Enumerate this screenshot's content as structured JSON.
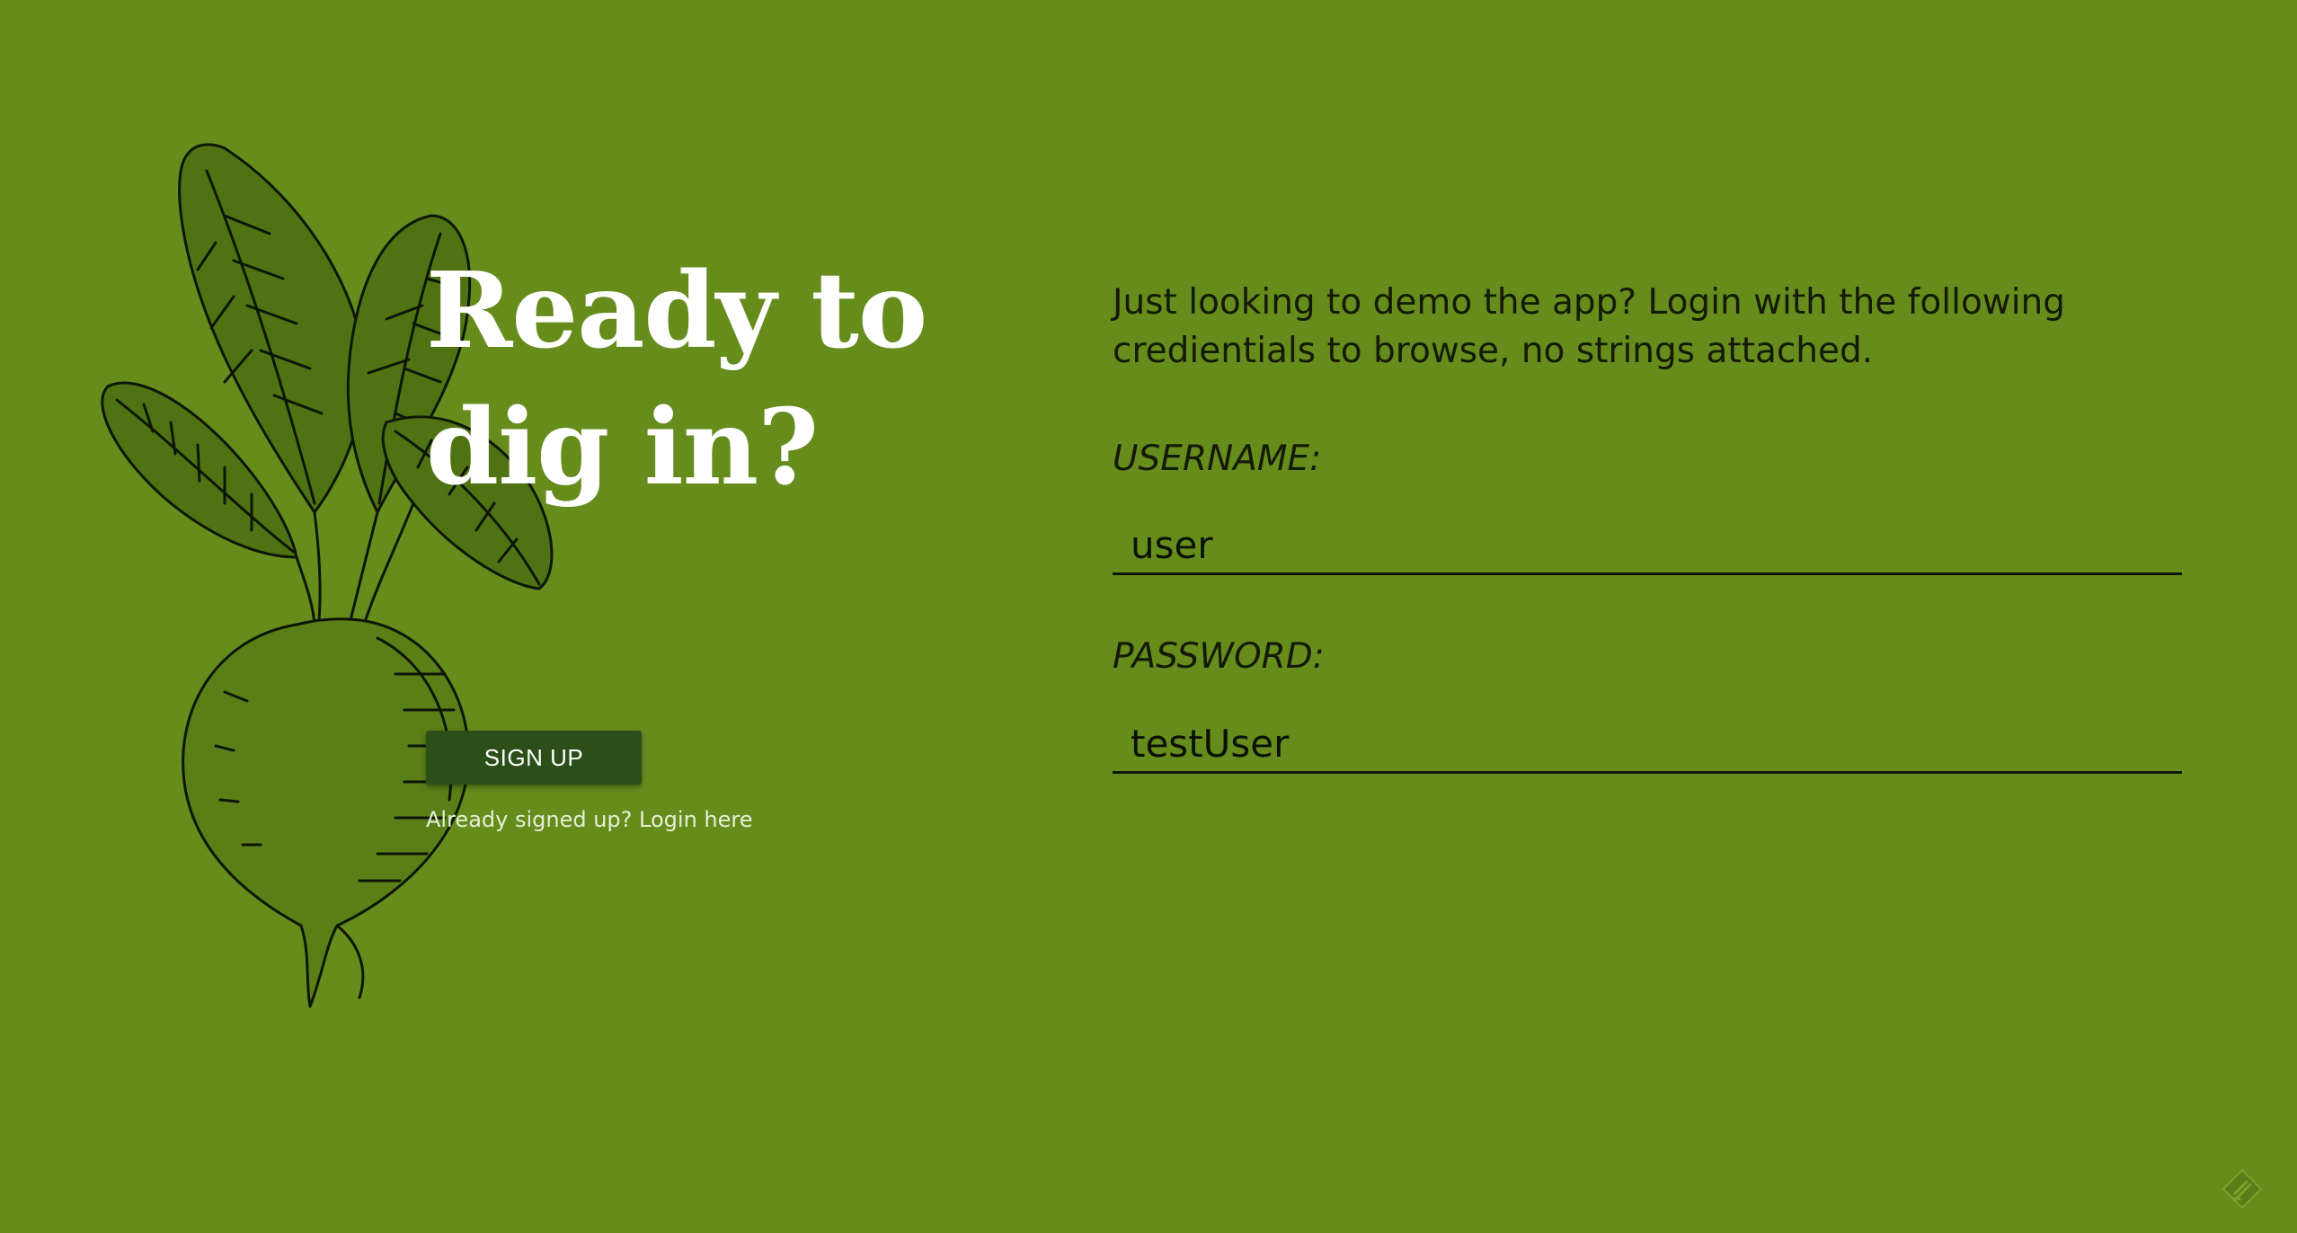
{
  "hero": {
    "headline_line1": "Ready to",
    "headline_line2": "dig in?",
    "signup_label": "SIGN UP",
    "login_prompt": "Already signed up?",
    "login_link": "Login here"
  },
  "demo": {
    "intro_line1": "Just looking to demo the app? Login with the following",
    "intro_line2": "credientials to browse, no strings attached.",
    "username_label": "USERNAME:",
    "username_value": "user",
    "password_label": "PASSWORD:",
    "password_value": "testUser"
  },
  "colors": {
    "background": "#668c1c",
    "button": "#2c4f19",
    "headline": "#ffffff",
    "text": "#141a05"
  },
  "icons": {
    "illustration": "beet-illustration",
    "corner": "feedback-icon"
  }
}
